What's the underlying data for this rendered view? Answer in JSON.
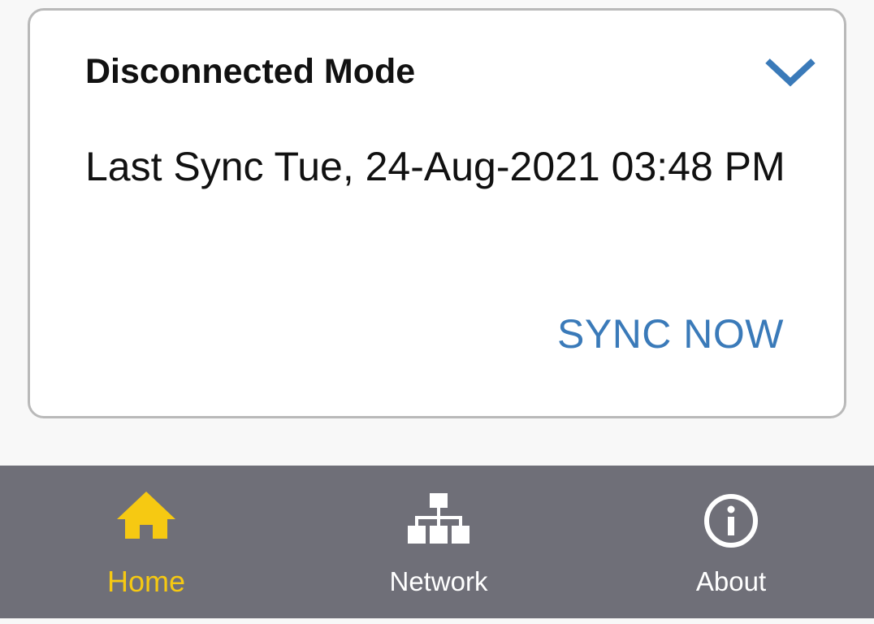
{
  "card": {
    "title": "Disconnected Mode",
    "expand_icon": "chevron-down-icon",
    "last_sync_text": "Last Sync Tue, 24-Aug-2021 03:48 PM",
    "sync_button_label": "SYNC NOW"
  },
  "bottom_nav": {
    "items": [
      {
        "label": "Home",
        "icon": "home-icon",
        "active": true
      },
      {
        "label": "Network",
        "icon": "network-icon",
        "active": false
      },
      {
        "label": "About",
        "icon": "info-icon",
        "active": false
      }
    ]
  },
  "colors": {
    "accent_blue": "#3a7ab9",
    "active_yellow": "#f6c912",
    "nav_background": "#6f6f78",
    "card_border": "#b9b9b9"
  }
}
